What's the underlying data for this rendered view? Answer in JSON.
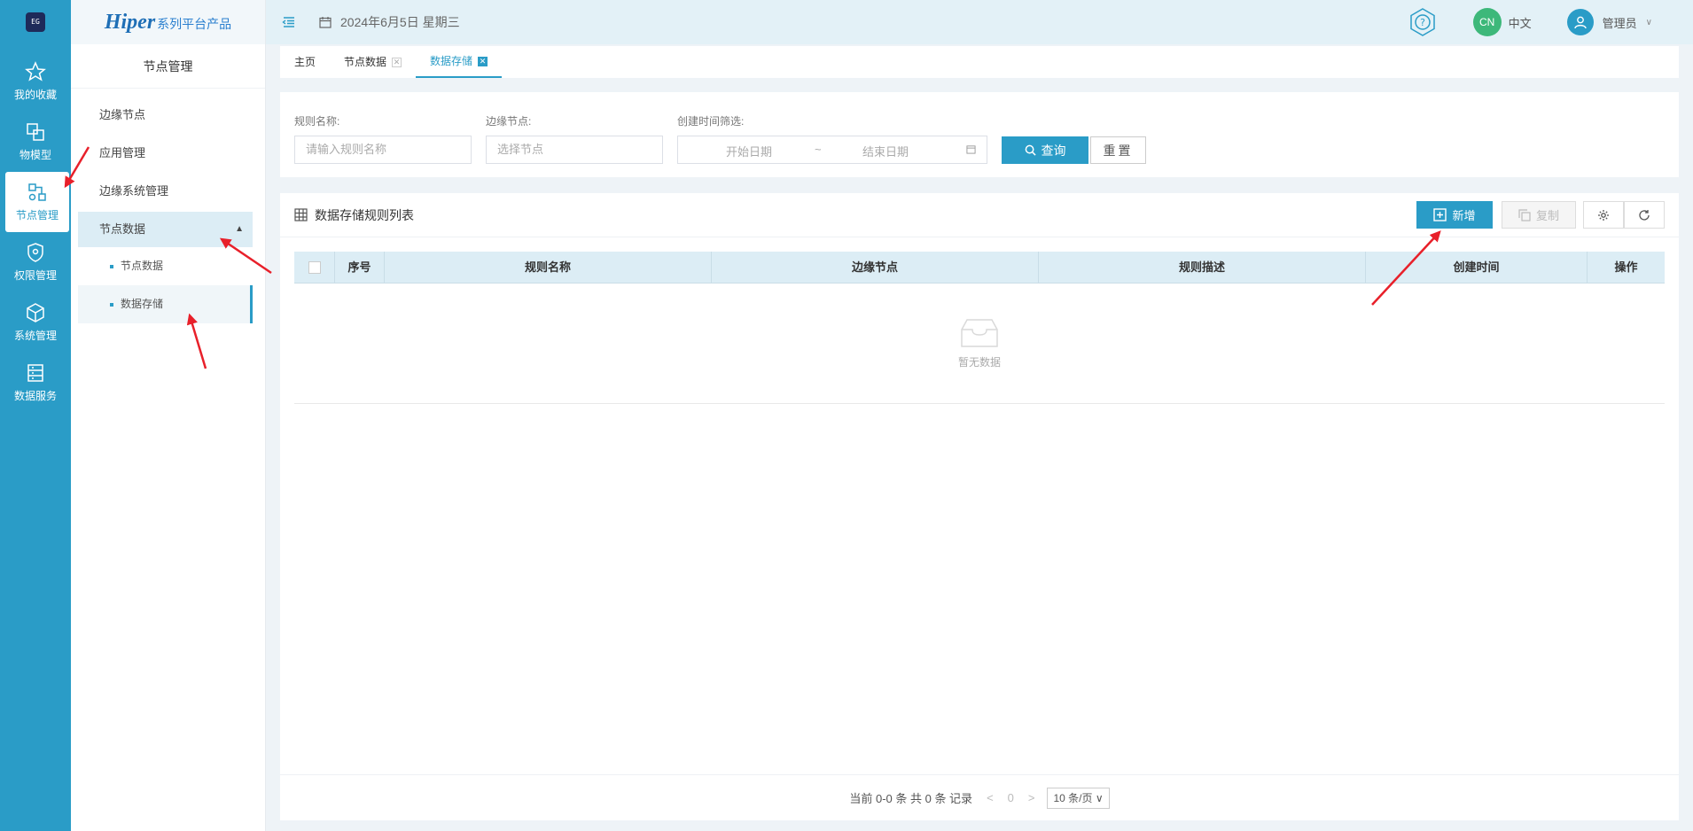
{
  "rail": {
    "logo": "EG",
    "items": [
      {
        "label": "我的收藏",
        "icon": "star-icon"
      },
      {
        "label": "物模型",
        "icon": "model-icon"
      },
      {
        "label": "节点管理",
        "icon": "node-icon"
      },
      {
        "label": "权限管理",
        "icon": "shield-icon"
      },
      {
        "label": "系统管理",
        "icon": "cube-icon"
      },
      {
        "label": "数据服务",
        "icon": "database-icon"
      }
    ]
  },
  "brand": {
    "name": "Hiper",
    "suffix": "系列平台产品"
  },
  "sidebar": {
    "title": "节点管理",
    "items": [
      "边缘节点",
      "应用管理",
      "边缘系统管理"
    ],
    "group": {
      "label": "节点数据",
      "caret": "^",
      "children": [
        "节点数据",
        "数据存储"
      ]
    }
  },
  "header": {
    "date": "2024年6月5日 星期三",
    "lang_badge": "CN",
    "lang_text": "中文",
    "user": "管理员",
    "user_caret": "∨"
  },
  "tabs": [
    {
      "label": "主页",
      "closable": false
    },
    {
      "label": "节点数据",
      "closable": true
    },
    {
      "label": "数据存储",
      "closable": true
    }
  ],
  "search": {
    "rule_name_label": "规则名称:",
    "rule_name_placeholder": "请输入规则名称",
    "edge_node_label": "边缘节点:",
    "edge_node_placeholder": "选择节点",
    "time_label": "创建时间筛选:",
    "start_placeholder": "开始日期",
    "range_sep": "~",
    "end_placeholder": "结束日期",
    "query_button": "查询",
    "reset_button": "重置"
  },
  "table": {
    "title": "数据存储规则列表",
    "add_button": "新增",
    "copy_button": "复制",
    "columns": [
      "序号",
      "规则名称",
      "边缘节点",
      "规则描述",
      "创建时间",
      "操作"
    ],
    "empty_text": "暂无数据"
  },
  "pager": {
    "summary": "当前 0-0 条 共 0 条 记录",
    "prev": "<",
    "page": "0",
    "next": ">",
    "page_size": "10 条/页 ∨"
  },
  "colors": {
    "primary": "#2a9cc7",
    "annotation": "#e8202a"
  }
}
